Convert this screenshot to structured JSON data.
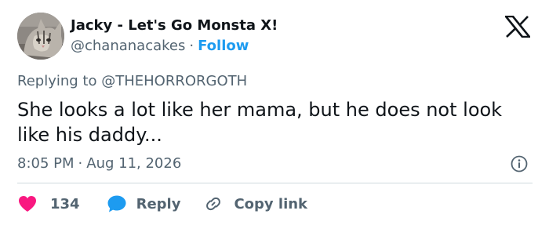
{
  "author": {
    "display_name": "Jacky - Let's Go Monsta X!",
    "handle": "@chananacakes",
    "separator": "·",
    "follow_label": "Follow",
    "avatar_icon": "cat-avatar"
  },
  "brand": {
    "logo_icon": "x-logo-icon"
  },
  "reply_context": {
    "prefix": "Replying to",
    "mention": "@THEHORRORGOTH"
  },
  "tweet": {
    "text": "She looks a lot like her mama, but he does not look like his daddy..."
  },
  "meta": {
    "time": "8:05 PM",
    "separator": "·",
    "date": "Aug 11, 2026",
    "info_icon": "info-icon"
  },
  "actions": {
    "like_count": "134",
    "reply_label": "Reply",
    "copy_link_label": "Copy link"
  },
  "colors": {
    "like": "#f91880",
    "reply": "#1d9bf0",
    "link": "#1d9bf0",
    "secondary_text": "#536471",
    "primary_text": "#0f1419",
    "divider": "#cfd9de"
  }
}
